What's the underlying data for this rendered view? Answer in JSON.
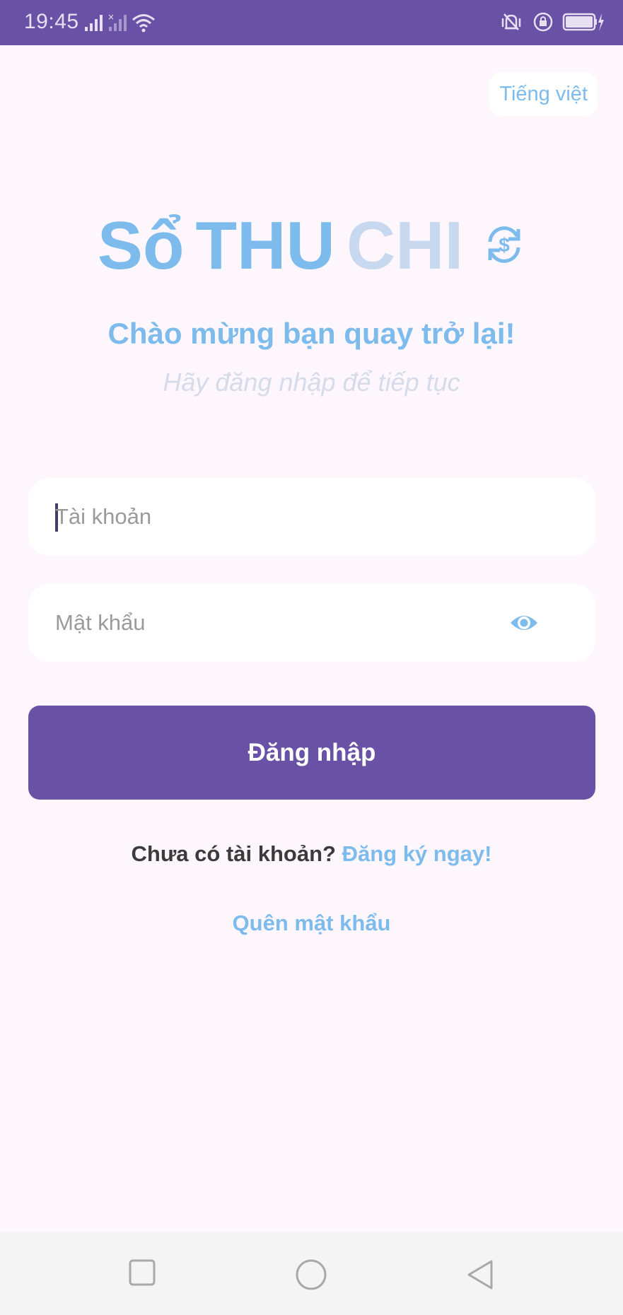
{
  "colors": {
    "accent": "#6951a5",
    "light_blue": "#7dbbed"
  },
  "status_bar": {
    "time": "19:45",
    "icons": [
      "signal-icon",
      "no-signal-icon",
      "wifi-icon",
      "vibrate-icon",
      "rotation-lock-icon",
      "battery-charging-icon"
    ]
  },
  "language": {
    "label": "Tiếng việt"
  },
  "app_title": {
    "part1": "Sổ",
    "part2": "THU",
    "part3": "CHI",
    "icon": "currency-exchange-icon"
  },
  "welcome": "Chào mừng bạn quay trở lại!",
  "subtitle": "Hãy đăng nhập để tiếp tục",
  "form": {
    "username_placeholder": "Tài khoản",
    "username_value": "",
    "password_placeholder": "Mật khẩu",
    "password_value": "",
    "eye_icon": "eye-icon",
    "login_label": "Đăng nhập"
  },
  "register": {
    "question": "Chưa có tài khoản?",
    "link": "Đăng ký ngay!"
  },
  "forgot_password": "Quên mật khẩu",
  "nav_bar": {
    "buttons": [
      "recents-icon",
      "home-icon",
      "back-icon"
    ]
  }
}
